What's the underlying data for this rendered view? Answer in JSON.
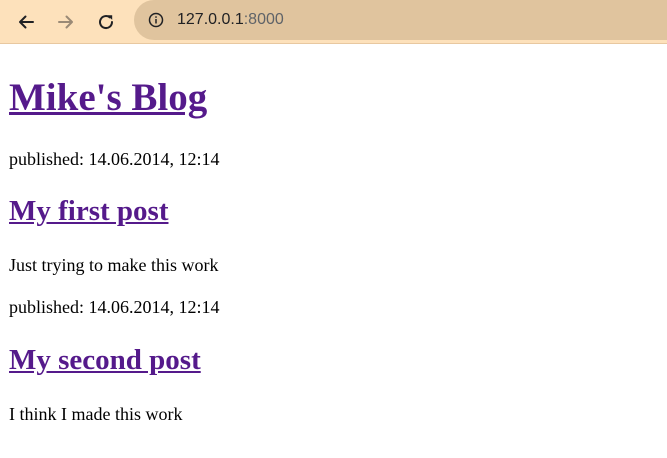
{
  "browser": {
    "address_host": "127.0.0.1",
    "address_port": ":8000",
    "toolbar_color": "#fde1bb"
  },
  "blog": {
    "title": "Mike's Blog",
    "link_color": "#551a8b",
    "posts": [
      {
        "published": "published: 14.06.2014, 12:14",
        "title": "My first post",
        "text": "Just trying to make this work"
      },
      {
        "published": "published: 14.06.2014, 12:14",
        "title": "My second post",
        "text": "I think I made this work"
      }
    ]
  }
}
